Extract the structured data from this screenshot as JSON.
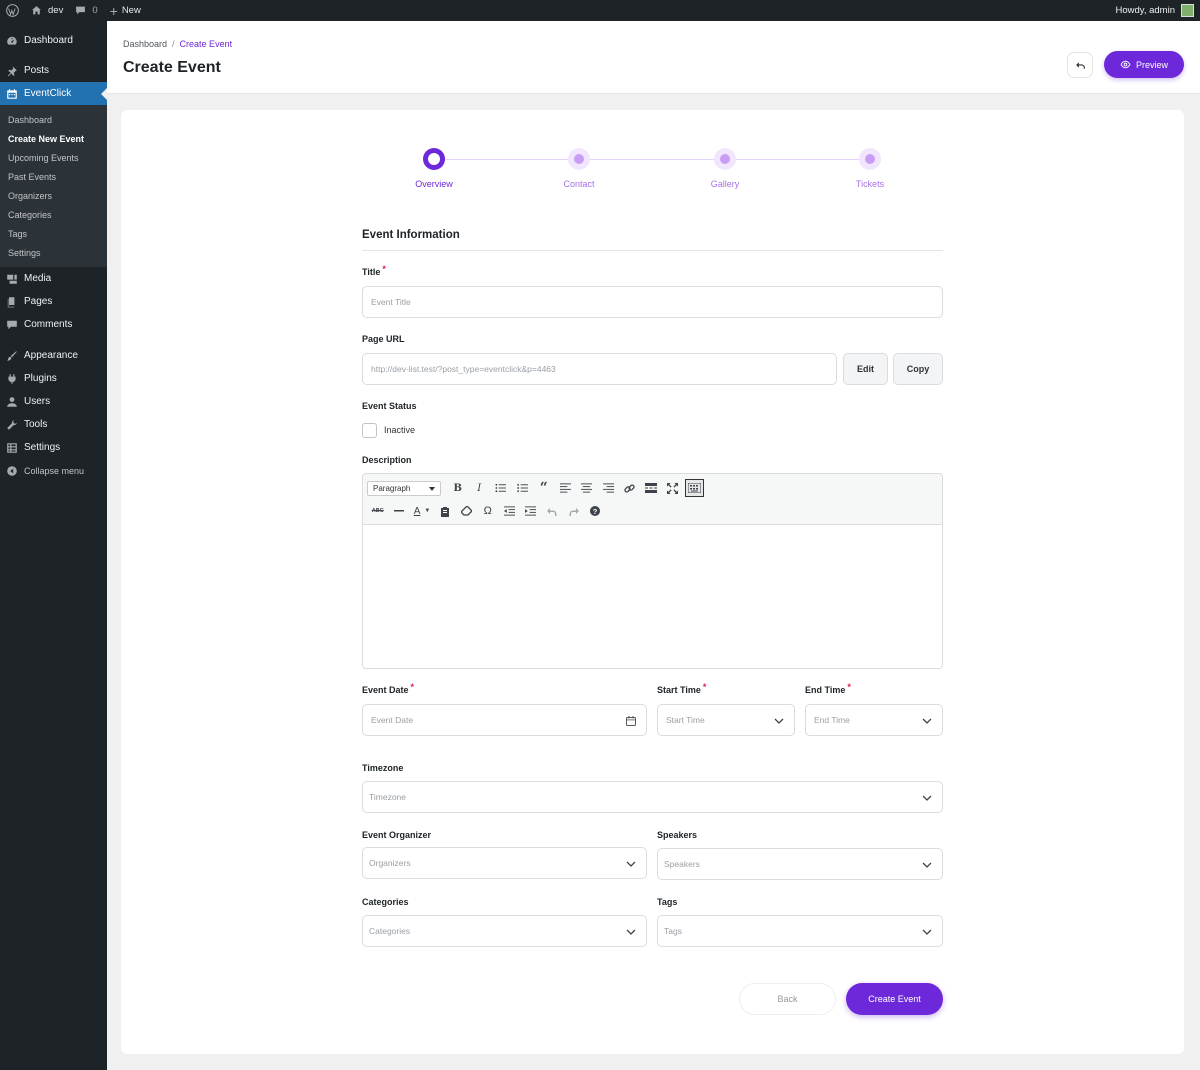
{
  "adminbar": {
    "site_name": "dev",
    "comments_count": "0",
    "new_label": "New",
    "greeting": "Howdy, admin"
  },
  "sidebar": {
    "items_top": [
      {
        "label": "Dashboard",
        "icon": "dashboard-icon"
      },
      {
        "label": "Posts",
        "icon": "pushpin-icon"
      },
      {
        "label": "EventClick",
        "icon": "calendar-icon"
      }
    ],
    "submenu": [
      "Dashboard",
      "Create New Event",
      "Upcoming Events",
      "Past Events",
      "Organizers",
      "Categories",
      "Tags",
      "Settings"
    ],
    "items_mid": [
      {
        "label": "Media",
        "icon": "media-icon"
      },
      {
        "label": "Pages",
        "icon": "pages-icon"
      },
      {
        "label": "Comments",
        "icon": "comment-icon"
      }
    ],
    "items_bottom": [
      {
        "label": "Appearance",
        "icon": "brush-icon"
      },
      {
        "label": "Plugins",
        "icon": "plugin-icon"
      },
      {
        "label": "Users",
        "icon": "users-icon"
      },
      {
        "label": "Tools",
        "icon": "wrench-icon"
      },
      {
        "label": "Settings",
        "icon": "settings-icon"
      },
      {
        "label": "Collapse menu",
        "icon": "collapse-icon"
      }
    ]
  },
  "header": {
    "breadcrumb_root": "Dashboard",
    "breadcrumb_sep": "/",
    "breadcrumb_current": "Create Event",
    "title": "Create Event",
    "preview_label": "Preview"
  },
  "stepper": {
    "steps": [
      "Overview",
      "Contact",
      "Gallery",
      "Tickets"
    ],
    "active_index": 0
  },
  "form": {
    "section_title": "Event Information",
    "title_label": "Title",
    "title_placeholder": "Event Title",
    "page_url_label": "Page URL",
    "page_url_value": "http://dev-list.test/?post_type=eventclick&p=4463",
    "edit_label": "Edit",
    "copy_label": "Copy",
    "status_label": "Event Status",
    "status_text": "Inactive",
    "description_label": "Description",
    "format_select": "Paragraph",
    "event_date_label": "Event Date",
    "event_date_placeholder": "Event Date",
    "start_time_label": "Start Time",
    "start_time_placeholder": "Start Time",
    "end_time_label": "End Time",
    "end_time_placeholder": "End Time",
    "timezone_label": "Timezone",
    "timezone_placeholder": "Timezone",
    "organizer_label": "Event Organizer",
    "organizer_placeholder": "Organizers",
    "speakers_label": "Speakers",
    "speakers_placeholder": "Speakers",
    "categories_label": "Categories",
    "categories_placeholder": "Categories",
    "tags_label": "Tags",
    "tags_placeholder": "Tags",
    "required_mark": "*",
    "back_label": "Back",
    "create_label": "Create Event"
  },
  "colors": {
    "accent": "#6d28d9",
    "wp_admin_blue": "#2271b1",
    "sidebar_bg": "#1d2327"
  }
}
